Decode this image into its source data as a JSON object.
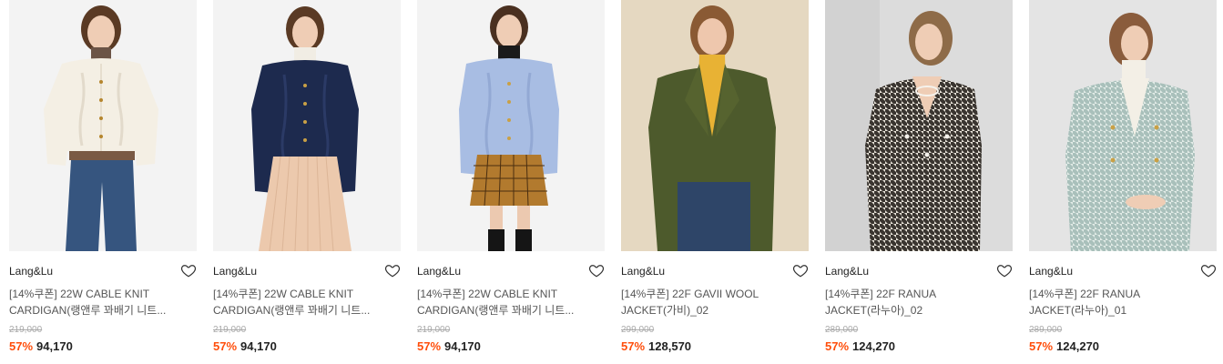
{
  "colors": {
    "discount": "#ff4e0b",
    "text": "#222222",
    "muted": "#aaaaaa"
  },
  "products": [
    {
      "brand": "Lang&Lu",
      "title_line1": "[14%쿠폰] 22W CABLE KNIT",
      "title_line2": "CARDIGAN(랭앤루 꽈배기 니트...",
      "original_price": "219,000",
      "discount": "57%",
      "price": "94,170",
      "wishlist_icon": "heart-outline-icon"
    },
    {
      "brand": "Lang&Lu",
      "title_line1": "[14%쿠폰] 22W CABLE KNIT",
      "title_line2": "CARDIGAN(랭앤루 꽈배기 니트...",
      "original_price": "219,000",
      "discount": "57%",
      "price": "94,170",
      "wishlist_icon": "heart-outline-icon"
    },
    {
      "brand": "Lang&Lu",
      "title_line1": "[14%쿠폰] 22W CABLE KNIT",
      "title_line2": "CARDIGAN(랭앤루 꽈배기 니트...",
      "original_price": "219,000",
      "discount": "57%",
      "price": "94,170",
      "wishlist_icon": "heart-outline-icon"
    },
    {
      "brand": "Lang&Lu",
      "title_line1": "[14%쿠폰] 22F GAVII WOOL",
      "title_line2": "JACKET(가비)_02",
      "original_price": "299,000",
      "discount": "57%",
      "price": "128,570",
      "wishlist_icon": "heart-outline-icon"
    },
    {
      "brand": "Lang&Lu",
      "title_line1": "[14%쿠폰] 22F RANUA",
      "title_line2": "JACKET(라누아)_02",
      "original_price": "289,000",
      "discount": "57%",
      "price": "124,270",
      "wishlist_icon": "heart-outline-icon"
    },
    {
      "brand": "Lang&Lu",
      "title_line1": "[14%쿠폰] 22F RANUA",
      "title_line2": "JACKET(라누아)_01",
      "original_price": "289,000",
      "discount": "57%",
      "price": "124,270",
      "wishlist_icon": "heart-outline-icon"
    }
  ]
}
